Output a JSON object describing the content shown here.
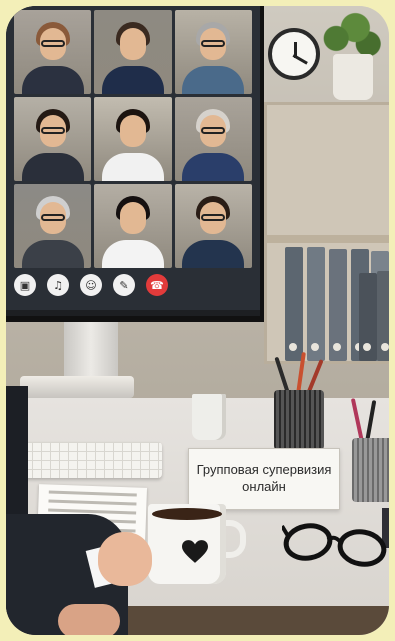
{
  "scene": {
    "sign_text": "Групповая супервизия онлайн"
  },
  "video_call": {
    "participants": [
      {
        "hair": "#8a5a3a",
        "shirt": "#2b3140",
        "bg": "#a8a29a",
        "glasses": true
      },
      {
        "hair": "#3a2a20",
        "shirt": "#1f2d4a",
        "bg": "#8e8a82",
        "glasses": false
      },
      {
        "hair": "#a8a8a8",
        "shirt": "#4a6a8a",
        "bg": "#b8b2a6",
        "glasses": true
      },
      {
        "hair": "#241a14",
        "shirt": "#2a2f3a",
        "bg": "#b5b0a6",
        "glasses": true
      },
      {
        "hair": "#1c1410",
        "shirt": "#f1f1f1",
        "bg": "#c2bcb0",
        "glasses": false
      },
      {
        "hair": "#d6d2cc",
        "shirt": "#2a3e6a",
        "bg": "#a9a39a",
        "glasses": true
      },
      {
        "hair": "#cfcfcf",
        "shirt": "#3b4048",
        "bg": "#8c8a86",
        "glasses": true
      },
      {
        "hair": "#151010",
        "shirt": "#f3f3f3",
        "bg": "#b4aea4",
        "glasses": false
      },
      {
        "hair": "#2a1d16",
        "shirt": "#23344e",
        "bg": "#b9b3a8",
        "glasses": true
      }
    ],
    "controls": [
      {
        "icon": "camera-icon",
        "glyph": "▣"
      },
      {
        "icon": "microphone-icon",
        "glyph": "♫"
      },
      {
        "icon": "participants-icon",
        "glyph": "☺"
      },
      {
        "icon": "chat-icon",
        "glyph": "✎"
      },
      {
        "icon": "hang-up-icon",
        "glyph": "☎"
      }
    ]
  },
  "colors": {
    "end_call": "#e23b3b",
    "frame_border": "#f3efb8"
  }
}
